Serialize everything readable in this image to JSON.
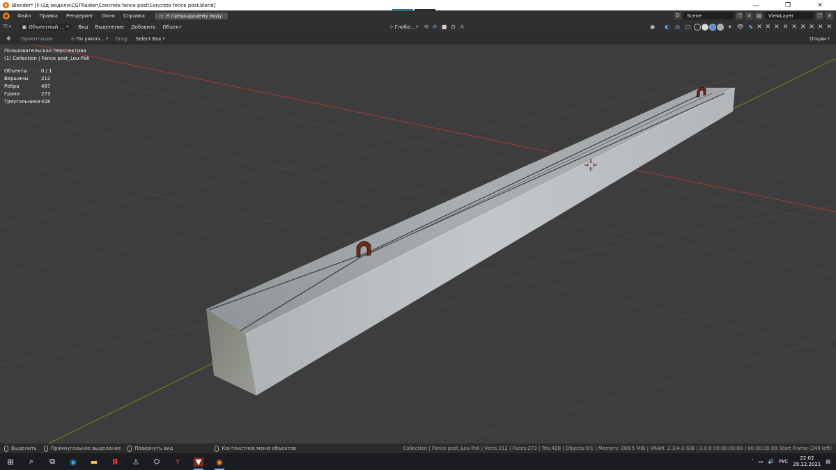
{
  "window": {
    "title": "Blender* [F:\\3д модели\\CGTRaider\\Concrete fence post\\Concrete fence post.blend]",
    "minimize": "—",
    "maximize": "❐",
    "close": "✕"
  },
  "topbar": {
    "menus": [
      "Файл",
      "Правка",
      "Рендеринг",
      "Окно",
      "Справка"
    ],
    "back_button": "К предыдущему виду",
    "scene": "Scene",
    "view_layer": "ViewLayer"
  },
  "header": {
    "mode": "Объектный ...",
    "menus": [
      "Вид",
      "Выделение",
      "Добавить",
      "Объект"
    ],
    "transform_orientation": "Глоба...",
    "options": "Опции"
  },
  "tool_settings": {
    "orientation_label": "Ориентация:",
    "orientation_value": "По умолч...",
    "drag_label": "Drag:",
    "drag_value": "Select Box"
  },
  "viewport": {
    "view_name": "Пользовательская перспектива",
    "collection": "(1) Collection | Fence post_Lou-Poli",
    "stats": [
      {
        "label": "Объекты",
        "value": "0 / 1"
      },
      {
        "label": "Вершины",
        "value": "212"
      },
      {
        "label": "Ребра",
        "value": "487"
      },
      {
        "label": "Грани",
        "value": "273"
      },
      {
        "label": "Треугольники",
        "value": "428"
      }
    ],
    "colors": {
      "background": "#3d3d3d",
      "x_axis": "#a83a3a",
      "y_axis": "#6d8a26",
      "grid": "#474747",
      "concrete_top": "#a6acb0",
      "concrete_side": "#bcc1c4",
      "concrete_end": "#868a82"
    }
  },
  "statusbar": {
    "hints": [
      "Выделить",
      "Прямоугольное выделение",
      "Повернуть вид",
      "Контекстное меню объектов"
    ],
    "info": "Collection | Fence post_Lou-Poli | Verts:212 | Faces:273 | Tris:428 | Objects:0/1 | Memory: 289.5 MiB | VRAM: 2.3/4.0 GiB | 3.0.0  00:00:00:00 / 00:00:10:09  Start Frame (249 left)"
  },
  "taskbar": {
    "language": "РУС",
    "time": "22:02",
    "date": "29.12.2021",
    "apps": [
      "start-icon",
      "search-icon",
      "task-view-icon",
      "edge-icon",
      "file-explorer-icon",
      "yandex-icon",
      "world-of-warships-icon",
      "world-of-tanks-icon",
      "yandex-browser-icon",
      "wot-game-icon",
      "blender-icon"
    ]
  }
}
